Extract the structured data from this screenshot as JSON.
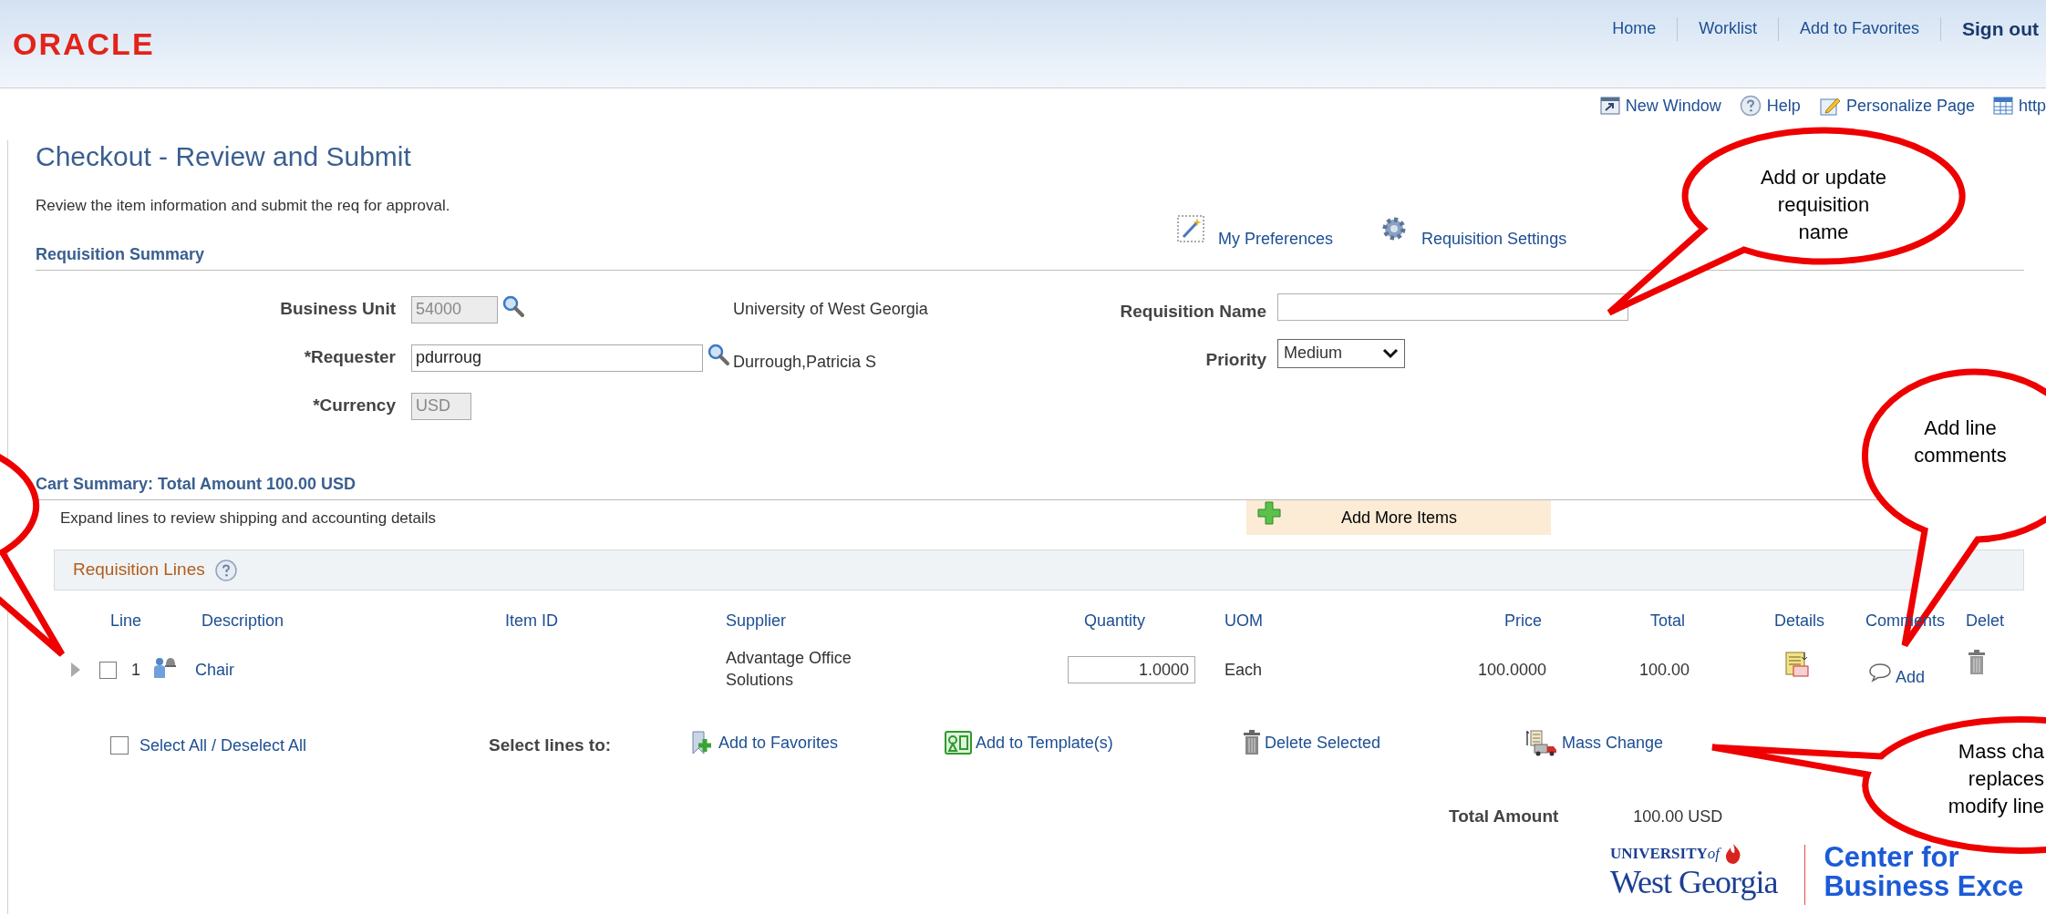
{
  "header": {
    "logo": "ORACLE",
    "nav": [
      {
        "label": "Home",
        "emphasized": false
      },
      {
        "label": "Worklist",
        "emphasized": false
      },
      {
        "label": "Add to Favorites",
        "emphasized": false
      },
      {
        "label": "Sign out",
        "emphasized": true
      }
    ]
  },
  "toolbar": [
    {
      "kind": "new-window",
      "label": "New Window"
    },
    {
      "kind": "help",
      "label": "Help"
    },
    {
      "kind": "personalize",
      "label": "Personalize Page"
    },
    {
      "kind": "link",
      "label": "http"
    }
  ],
  "page": {
    "title": "Checkout - Review and Submit",
    "instructions": "Review the item information and submit the req for approval.",
    "links": [
      {
        "kind": "preferences",
        "label": "My Preferences"
      },
      {
        "kind": "settings",
        "label": "Requisition Settings"
      }
    ]
  },
  "requisition_summary": {
    "heading": "Requisition Summary",
    "left_fields": [
      {
        "label": "Business Unit",
        "value": "54000",
        "disabled": true,
        "lookup": true,
        "description": "University of West Georgia"
      },
      {
        "label": "*Requester",
        "value": "pdurroug",
        "disabled": false,
        "lookup": true,
        "description": "Durrough,Patricia S"
      },
      {
        "label": "*Currency",
        "value": "USD",
        "disabled": true,
        "lookup": false
      }
    ],
    "right_fields": [
      {
        "kind": "text",
        "label": "Requisition Name"
      },
      {
        "kind": "select",
        "label": "Priority",
        "value": "Medium"
      }
    ]
  },
  "cart_summary": {
    "heading": "Cart Summary: Total Amount 100.00 USD",
    "hint": "Expand lines to review shipping and accounting details",
    "add_more_items": "Add More Items",
    "requisition_lines": {
      "title": "Requisition Lines",
      "columns": [
        "Line",
        "Description",
        "Item ID",
        "Supplier",
        "Quantity",
        "UOM",
        "Price",
        "Total",
        "Details",
        "Comments",
        "Delet"
      ],
      "rows": [
        {
          "expanded": false,
          "selected": false,
          "line": "1",
          "description": "Chair",
          "supplier": "Advantage Office Solutions",
          "quantity": "1.0000",
          "uom": "Each",
          "price": "100.0000",
          "total": "100.00",
          "comments_link": "Add"
        }
      ]
    },
    "select_all": {
      "label": "Select All / Deselect All",
      "checked": false
    },
    "actions_label": "Select lines to:",
    "actions": [
      {
        "kind": "favorites",
        "label": "Add to Favorites"
      },
      {
        "kind": "template",
        "label": "Add to Template(s)"
      },
      {
        "kind": "delete",
        "label": "Delete Selected"
      },
      {
        "kind": "mass-change",
        "label": "Mass Change"
      }
    ],
    "total_label": "Total Amount",
    "total_value": "100.00 USD"
  },
  "footer_logo": {
    "university": "UNIVERSITY",
    "of": "of",
    "name": "West Georgia",
    "center_lines": [
      "Center for",
      "Business Exce"
    ]
  },
  "callouts": [
    {
      "lines": [
        "Add or update",
        "requisition",
        "name"
      ]
    },
    {
      "lines": [
        "Add line",
        "comments"
      ]
    },
    {
      "lines": [
        "Mass cha",
        "replaces",
        "modify line"
      ]
    }
  ]
}
